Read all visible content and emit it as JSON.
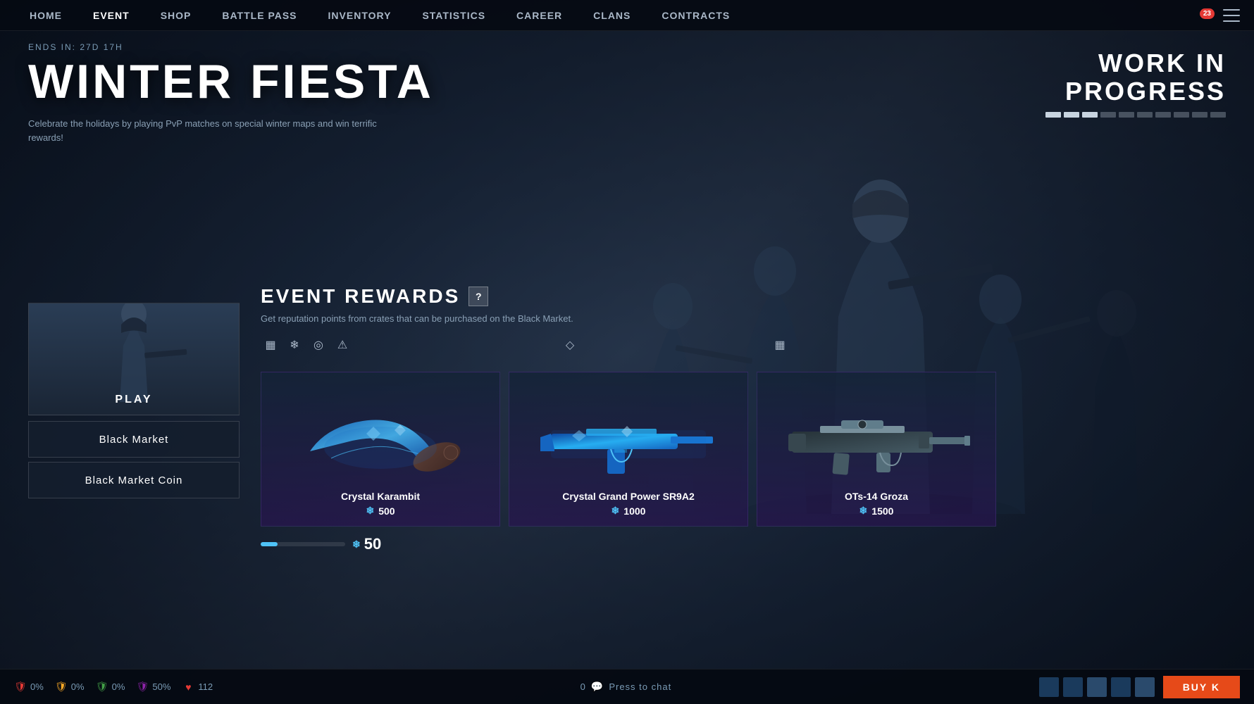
{
  "nav": {
    "items": [
      {
        "id": "home",
        "label": "HOME",
        "active": false
      },
      {
        "id": "event",
        "label": "EVENT",
        "active": true
      },
      {
        "id": "shop",
        "label": "SHOP",
        "active": false
      },
      {
        "id": "battle_pass",
        "label": "BATTLE PASS",
        "active": false
      },
      {
        "id": "inventory",
        "label": "INVENTORY",
        "active": false
      },
      {
        "id": "statistics",
        "label": "STATISTICS",
        "active": false
      },
      {
        "id": "career",
        "label": "CAREER",
        "active": false
      },
      {
        "id": "clans",
        "label": "CLANS",
        "active": false
      },
      {
        "id": "contracts",
        "label": "CONTRACTS",
        "active": false
      }
    ],
    "notification_count": "23",
    "hamburger_label": "Menu"
  },
  "event": {
    "ends_in_label": "ENDS IN:",
    "ends_in_value": "27D 17H",
    "title": "WINTER FIESTA",
    "description": "Celebrate the holidays by playing PvP matches on special winter maps and win terrific rewards!"
  },
  "wip": {
    "title": "WORK IN\nPROGRESS",
    "segments_total": 10,
    "segments_filled": 3
  },
  "left_panel": {
    "play_label": "PLAY",
    "black_market_label": "Black Market",
    "black_market_coin_label": "Black Market Coin"
  },
  "rewards": {
    "title": "EVENT REWARDS",
    "help_icon": "?",
    "description": "Get reputation points from crates that can be purchased on the Black Market.",
    "items": [
      {
        "name": "Crystal Karambit",
        "cost": "500",
        "tier_icons": [
          "▦",
          "❄",
          "◎",
          "⚠"
        ]
      },
      {
        "name": "Crystal Grand Power SR9A2",
        "cost": "1000",
        "tier_icons": [
          "◇"
        ]
      },
      {
        "name": "OTs-14 Groza",
        "cost": "1500",
        "tier_icons": [
          "▦"
        ]
      }
    ],
    "progress_points": "50",
    "snowflake_symbol": "❄"
  },
  "bottom_bar": {
    "stats": [
      {
        "id": "shield1",
        "icon": "🛡",
        "value": "0%",
        "color": "#e53935"
      },
      {
        "id": "shield2",
        "icon": "🛡",
        "value": "0%",
        "color": "#f9a825"
      },
      {
        "id": "shield3",
        "icon": "🛡",
        "value": "0%",
        "color": "#43a047"
      },
      {
        "id": "shield4",
        "icon": "🛡",
        "value": "50%",
        "color": "#8e24aa"
      },
      {
        "id": "heart",
        "icon": "♥",
        "value": "112",
        "color": "#e53935"
      }
    ],
    "chat_count": "0",
    "press_to_chat": "Press to chat",
    "buy_label": "BUY K"
  }
}
